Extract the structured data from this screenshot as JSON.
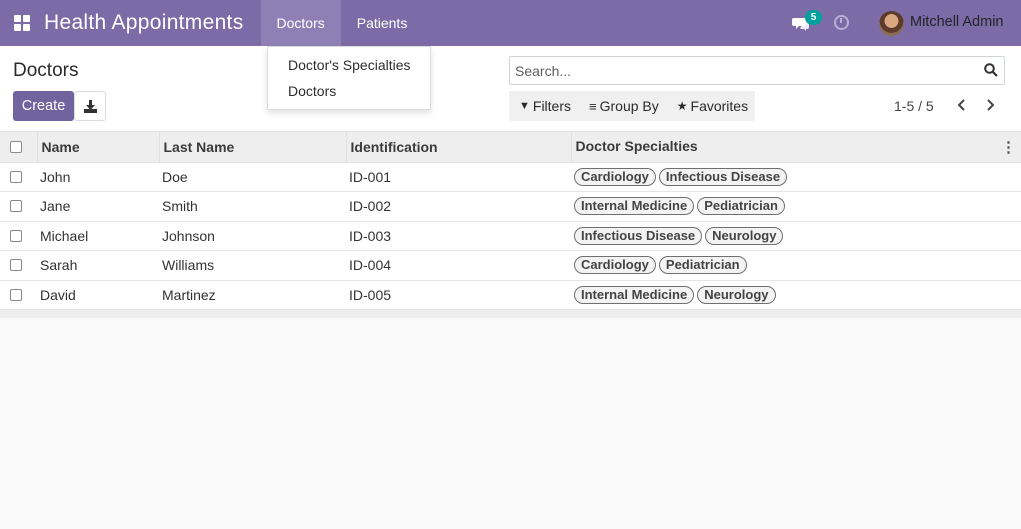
{
  "navbar": {
    "app_title": "Health Appointments",
    "menus": [
      {
        "label": "Doctors",
        "active": true
      },
      {
        "label": "Patients",
        "active": false
      }
    ],
    "chat_count": "5",
    "user_name": "Mitchell Admin",
    "background_color": "#7c6ba6"
  },
  "dropdown": {
    "items": [
      "Doctor's Specialties",
      "Doctors"
    ]
  },
  "control_panel": {
    "title": "Doctors",
    "create_label": "Create",
    "search_placeholder": "Search...",
    "filters_label": "Filters",
    "group_by_label": "Group By",
    "favorites_label": "Favorites",
    "pager_value": "1-5 / 5"
  },
  "table": {
    "columns": [
      "Name",
      "Last Name",
      "Identification",
      "Doctor Specialties"
    ],
    "rows": [
      {
        "name": "John",
        "last_name": "Doe",
        "identification": "ID-001",
        "specialties": [
          "Cardiology",
          "Infectious Disease"
        ]
      },
      {
        "name": "Jane",
        "last_name": "Smith",
        "identification": "ID-002",
        "specialties": [
          "Internal Medicine",
          "Pediatrician"
        ]
      },
      {
        "name": "Michael",
        "last_name": "Johnson",
        "identification": "ID-003",
        "specialties": [
          "Infectious Disease",
          "Neurology"
        ]
      },
      {
        "name": "Sarah",
        "last_name": "Williams",
        "identification": "ID-004",
        "specialties": [
          "Cardiology",
          "Pediatrician"
        ]
      },
      {
        "name": "David",
        "last_name": "Martinez",
        "identification": "ID-005",
        "specialties": [
          "Internal Medicine",
          "Neurology"
        ]
      }
    ]
  }
}
